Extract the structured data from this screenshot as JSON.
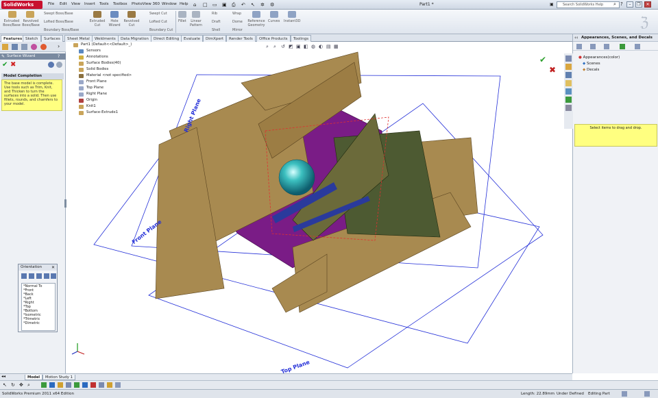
{
  "app": {
    "name": "SolidWorks",
    "document_title": "Part1 *"
  },
  "menu": [
    "File",
    "Edit",
    "View",
    "Insert",
    "Tools",
    "Toolbox",
    "PhotoView 360",
    "Window",
    "Help"
  ],
  "search": {
    "placeholder": "Search SolidWorks Help"
  },
  "command_manager": {
    "col1": [
      "Extruded",
      "Boss/Base",
      "Revolved",
      "Boss/Base"
    ],
    "col2": [
      "Swept Boss/Base",
      "Lofted Boss/Base",
      "Boundary Boss/Base"
    ],
    "col3": [
      "Extruded",
      "Cut",
      "Hole",
      "Wizard",
      "Revolved",
      "Cut"
    ],
    "col4": [
      "Swept Cut",
      "Lofted Cut",
      "Boundary Cut"
    ],
    "col5": [
      "Fillet",
      "Linear",
      "Pattern"
    ],
    "col6": [
      "Rib",
      "Draft",
      "Shell"
    ],
    "col7": [
      "Wrap",
      "Dome",
      "Mirror"
    ],
    "col8": [
      "Reference",
      "Geometry",
      "Curves",
      "Instant3D"
    ]
  },
  "tabs": [
    "Features",
    "Sketch",
    "Surfaces",
    "Sheet Metal",
    "Weldments",
    "Data Migration",
    "Direct Editing",
    "Evaluate",
    "DimXpert",
    "Render Tools",
    "Office Products",
    "Toolings"
  ],
  "left_panel": {
    "wizard_title": "Surface Wizard",
    "section_title": "Model Completion",
    "message": "The base model is complete. Use tools such as Trim, Knit, and Thicken to turn the surfaces into a solid. Then use fillets, rounds, and chamfers to your model."
  },
  "orientation": {
    "title": "Orientation",
    "views": [
      "*Normal To",
      "*Front",
      "*Back",
      "*Left",
      "*Right",
      "*Top",
      "*Bottom",
      "*Isometric",
      "*Trimetric",
      "*Dimetric"
    ]
  },
  "feature_tree": [
    "Part1 (Default<<Default>_)",
    "Sensors",
    "Annotations",
    "Surface Bodies(40)",
    "Solid Bodies",
    "Material <not specified>",
    "Front Plane",
    "Top Plane",
    "Right Plane",
    "Origin",
    "Knit1",
    "Surface-Extrude1"
  ],
  "plane_labels": {
    "right": "Right Plane",
    "front": "Front Plane",
    "top": "Top Plane"
  },
  "task_pane": {
    "title": "Appearances, Scenes, and Decals",
    "items": [
      "Appearances(color)",
      "Scenes",
      "Decals"
    ],
    "hint": "Select items to drag and drop."
  },
  "bottom_tabs": [
    "Model",
    "Motion Study 1"
  ],
  "status": {
    "edition": "SolidWorks Premium 2011 x64 Edition",
    "length": "Length: 22.89mm",
    "definition": "Under Defined",
    "mode": "Editing Part"
  },
  "colors": {
    "surface_tan": "#a88a50",
    "surface_purple": "#7a1c86",
    "surface_green": "#4d5a32",
    "sphere": "#2aa8a8",
    "plane_blue": "#1f2fd0"
  }
}
